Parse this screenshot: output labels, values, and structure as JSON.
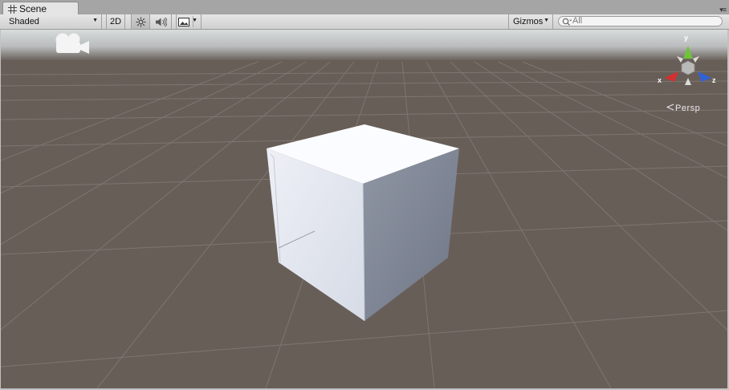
{
  "window": {
    "tab_label": "Scene",
    "tab_icon": "grid-icon",
    "tab_menu_icon": "tab-menu-icon"
  },
  "toolbar": {
    "shading_mode": "Shaded",
    "mode_2d_label": "2D",
    "lighting_icon": "sun-icon",
    "audio_icon": "speaker-icon",
    "effects_icon": "image-icon",
    "gizmos_label": "Gizmos",
    "search_placeholder": "All"
  },
  "viewport": {
    "projection_label": "Persp",
    "axis_labels": {
      "x": "x",
      "y": "y",
      "z": "z"
    },
    "colors": {
      "ground": "#685e58",
      "sky": "#d8dcdd",
      "grid_line": "#827975",
      "x_axis": "#d62f2f",
      "y_axis": "#6fc23a",
      "z_axis": "#2f62d6",
      "cube_top": "#fbfcff",
      "cube_left": "#dfe3ee",
      "cube_right": "#7a8291"
    }
  }
}
